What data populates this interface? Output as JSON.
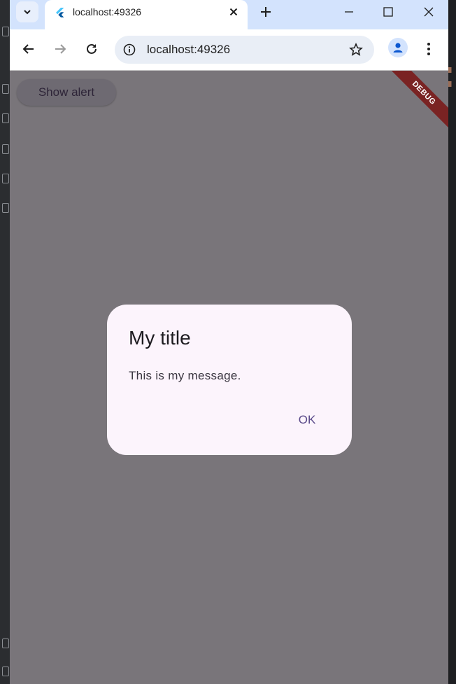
{
  "browser": {
    "tab_title": "localhost:49326",
    "url": "localhost:49326"
  },
  "app": {
    "show_alert_label": "Show alert",
    "debug_banner": "DEBUG"
  },
  "dialog": {
    "title": "My title",
    "message": "This is my message.",
    "ok_label": "OK"
  },
  "colors": {
    "tabbar_bg": "#d3e3fd",
    "scrim": "#79757a",
    "dialog_bg": "#fcf4fc",
    "accent": "#5b4b8a",
    "debug_ribbon": "#7a2323"
  }
}
